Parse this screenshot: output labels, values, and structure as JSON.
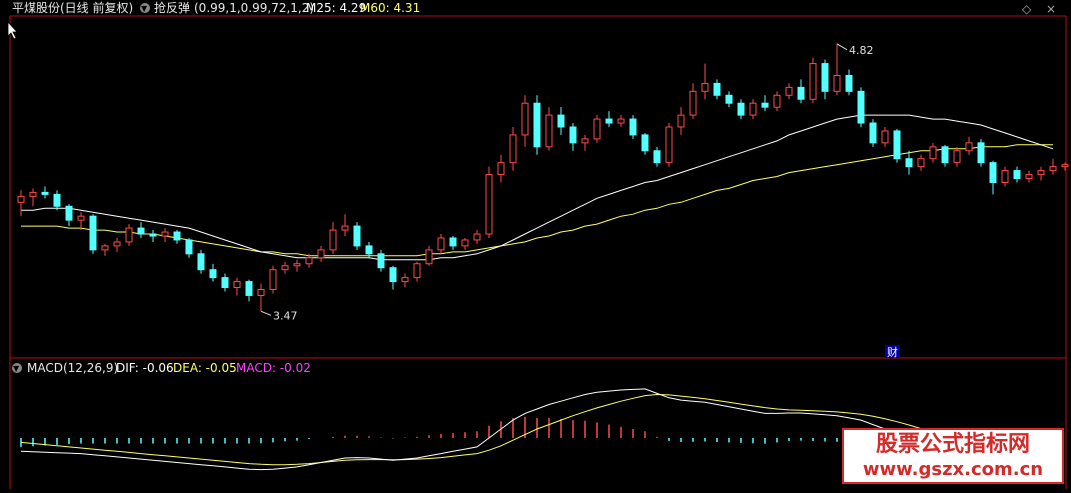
{
  "header": {
    "stock_title": "平煤股份(日线 前复权)",
    "indicator_name": "抢反弹",
    "indicator_params": "(0.99,1,0.99,72,1,2)",
    "m25_label": "M25: 4.29",
    "m60_label": "M60: 4.31"
  },
  "macd_header": {
    "label": "MACD(12,26,9)",
    "dif_label": "DIF: -0.06",
    "dea_label": "DEA: -0.05",
    "macd_label": "MACD: -0.02"
  },
  "markers": {
    "finance_label": "财"
  },
  "watermark": {
    "line1": "股票公式指标网",
    "line2": "www.gszx.com.cn"
  },
  "colors": {
    "up": "#ff4a4a",
    "down": "#54ffff",
    "ma25": "#ffffff",
    "ma60": "#ffff60",
    "dif": "#ffffff",
    "dea": "#ffff60",
    "macd_label": "#ff40ff",
    "border": "#b01010",
    "watermark": "#d42a2a"
  },
  "chart_data": [
    {
      "type": "candlestick",
      "title": "",
      "y_range": [
        3.3,
        4.95
      ],
      "annotations": [
        {
          "text": "4.82",
          "index": 68,
          "value": 4.82
        },
        {
          "text": "3.47",
          "index": 20,
          "value": 3.47
        }
      ],
      "series_legend": [
        {
          "name": "M25",
          "value": 4.29
        },
        {
          "name": "M60",
          "value": 4.31
        }
      ],
      "candles": [
        {
          "o": 4.02,
          "h": 4.08,
          "l": 3.95,
          "c": 4.05
        },
        {
          "o": 4.05,
          "h": 4.09,
          "l": 4.0,
          "c": 4.07
        },
        {
          "o": 4.07,
          "h": 4.1,
          "l": 4.04,
          "c": 4.06
        },
        {
          "o": 4.06,
          "h": 4.08,
          "l": 3.98,
          "c": 4.0
        },
        {
          "o": 4.0,
          "h": 4.01,
          "l": 3.9,
          "c": 3.93
        },
        {
          "o": 3.93,
          "h": 3.97,
          "l": 3.88,
          "c": 3.95
        },
        {
          "o": 3.95,
          "h": 3.96,
          "l": 3.76,
          "c": 3.78
        },
        {
          "o": 3.78,
          "h": 3.81,
          "l": 3.75,
          "c": 3.8
        },
        {
          "o": 3.8,
          "h": 3.84,
          "l": 3.77,
          "c": 3.82
        },
        {
          "o": 3.82,
          "h": 3.91,
          "l": 3.8,
          "c": 3.89
        },
        {
          "o": 3.89,
          "h": 3.92,
          "l": 3.84,
          "c": 3.86
        },
        {
          "o": 3.86,
          "h": 3.88,
          "l": 3.82,
          "c": 3.85
        },
        {
          "o": 3.85,
          "h": 3.89,
          "l": 3.82,
          "c": 3.87
        },
        {
          "o": 3.87,
          "h": 3.88,
          "l": 3.81,
          "c": 3.83
        },
        {
          "o": 3.83,
          "h": 3.84,
          "l": 3.74,
          "c": 3.76
        },
        {
          "o": 3.76,
          "h": 3.78,
          "l": 3.66,
          "c": 3.68
        },
        {
          "o": 3.68,
          "h": 3.71,
          "l": 3.62,
          "c": 3.64
        },
        {
          "o": 3.64,
          "h": 3.66,
          "l": 3.57,
          "c": 3.59
        },
        {
          "o": 3.59,
          "h": 3.64,
          "l": 3.55,
          "c": 3.62
        },
        {
          "o": 3.62,
          "h": 3.63,
          "l": 3.52,
          "c": 3.55
        },
        {
          "o": 3.55,
          "h": 3.61,
          "l": 3.47,
          "c": 3.58
        },
        {
          "o": 3.58,
          "h": 3.7,
          "l": 3.56,
          "c": 3.68
        },
        {
          "o": 3.68,
          "h": 3.72,
          "l": 3.66,
          "c": 3.7
        },
        {
          "o": 3.7,
          "h": 3.73,
          "l": 3.67,
          "c": 3.71
        },
        {
          "o": 3.71,
          "h": 3.76,
          "l": 3.69,
          "c": 3.74
        },
        {
          "o": 3.74,
          "h": 3.8,
          "l": 3.72,
          "c": 3.78
        },
        {
          "o": 3.78,
          "h": 3.92,
          "l": 3.76,
          "c": 3.88
        },
        {
          "o": 3.88,
          "h": 3.96,
          "l": 3.85,
          "c": 3.9
        },
        {
          "o": 3.9,
          "h": 3.92,
          "l": 3.78,
          "c": 3.8
        },
        {
          "o": 3.8,
          "h": 3.82,
          "l": 3.74,
          "c": 3.76
        },
        {
          "o": 3.76,
          "h": 3.78,
          "l": 3.67,
          "c": 3.69
        },
        {
          "o": 3.69,
          "h": 3.7,
          "l": 3.58,
          "c": 3.62
        },
        {
          "o": 3.62,
          "h": 3.66,
          "l": 3.59,
          "c": 3.64
        },
        {
          "o": 3.64,
          "h": 3.72,
          "l": 3.62,
          "c": 3.71
        },
        {
          "o": 3.71,
          "h": 3.8,
          "l": 3.7,
          "c": 3.78
        },
        {
          "o": 3.78,
          "h": 3.86,
          "l": 3.76,
          "c": 3.84
        },
        {
          "o": 3.84,
          "h": 3.85,
          "l": 3.78,
          "c": 3.8
        },
        {
          "o": 3.8,
          "h": 3.84,
          "l": 3.78,
          "c": 3.83
        },
        {
          "o": 3.83,
          "h": 3.88,
          "l": 3.81,
          "c": 3.86
        },
        {
          "o": 3.86,
          "h": 4.2,
          "l": 3.84,
          "c": 4.16
        },
        {
          "o": 4.16,
          "h": 4.26,
          "l": 4.12,
          "c": 4.22
        },
        {
          "o": 4.22,
          "h": 4.4,
          "l": 4.18,
          "c": 4.36
        },
        {
          "o": 4.36,
          "h": 4.56,
          "l": 4.3,
          "c": 4.52
        },
        {
          "o": 4.52,
          "h": 4.56,
          "l": 4.26,
          "c": 4.3
        },
        {
          "o": 4.3,
          "h": 4.5,
          "l": 4.28,
          "c": 4.46
        },
        {
          "o": 4.46,
          "h": 4.5,
          "l": 4.36,
          "c": 4.4
        },
        {
          "o": 4.4,
          "h": 4.42,
          "l": 4.28,
          "c": 4.32
        },
        {
          "o": 4.32,
          "h": 4.36,
          "l": 4.28,
          "c": 4.34
        },
        {
          "o": 4.34,
          "h": 4.46,
          "l": 4.32,
          "c": 4.44
        },
        {
          "o": 4.44,
          "h": 4.48,
          "l": 4.4,
          "c": 4.42
        },
        {
          "o": 4.42,
          "h": 4.46,
          "l": 4.4,
          "c": 4.44
        },
        {
          "o": 4.44,
          "h": 4.46,
          "l": 4.34,
          "c": 4.36
        },
        {
          "o": 4.36,
          "h": 4.37,
          "l": 4.26,
          "c": 4.28
        },
        {
          "o": 4.28,
          "h": 4.3,
          "l": 4.2,
          "c": 4.22
        },
        {
          "o": 4.22,
          "h": 4.42,
          "l": 4.2,
          "c": 4.4
        },
        {
          "o": 4.4,
          "h": 4.5,
          "l": 4.36,
          "c": 4.46
        },
        {
          "o": 4.46,
          "h": 4.62,
          "l": 4.44,
          "c": 4.58
        },
        {
          "o": 4.58,
          "h": 4.72,
          "l": 4.54,
          "c": 4.62
        },
        {
          "o": 4.62,
          "h": 4.64,
          "l": 4.54,
          "c": 4.56
        },
        {
          "o": 4.56,
          "h": 4.58,
          "l": 4.5,
          "c": 4.52
        },
        {
          "o": 4.52,
          "h": 4.54,
          "l": 4.44,
          "c": 4.46
        },
        {
          "o": 4.46,
          "h": 4.54,
          "l": 4.44,
          "c": 4.52
        },
        {
          "o": 4.52,
          "h": 4.56,
          "l": 4.48,
          "c": 4.5
        },
        {
          "o": 4.5,
          "h": 4.58,
          "l": 4.48,
          "c": 4.56
        },
        {
          "o": 4.56,
          "h": 4.62,
          "l": 4.54,
          "c": 4.6
        },
        {
          "o": 4.6,
          "h": 4.64,
          "l": 4.52,
          "c": 4.54
        },
        {
          "o": 4.54,
          "h": 4.75,
          "l": 4.52,
          "c": 4.72
        },
        {
          "o": 4.72,
          "h": 4.74,
          "l": 4.54,
          "c": 4.58
        },
        {
          "o": 4.58,
          "h": 4.82,
          "l": 4.56,
          "c": 4.66
        },
        {
          "o": 4.66,
          "h": 4.69,
          "l": 4.56,
          "c": 4.58
        },
        {
          "o": 4.58,
          "h": 4.6,
          "l": 4.4,
          "c": 4.42
        },
        {
          "o": 4.42,
          "h": 4.44,
          "l": 4.3,
          "c": 4.32
        },
        {
          "o": 4.32,
          "h": 4.4,
          "l": 4.3,
          "c": 4.38
        },
        {
          "o": 4.38,
          "h": 4.39,
          "l": 4.22,
          "c": 4.24
        },
        {
          "o": 4.24,
          "h": 4.28,
          "l": 4.16,
          "c": 4.2
        },
        {
          "o": 4.2,
          "h": 4.26,
          "l": 4.18,
          "c": 4.24
        },
        {
          "o": 4.24,
          "h": 4.32,
          "l": 4.22,
          "c": 4.3
        },
        {
          "o": 4.3,
          "h": 4.31,
          "l": 4.2,
          "c": 4.22
        },
        {
          "o": 4.22,
          "h": 4.3,
          "l": 4.2,
          "c": 4.28
        },
        {
          "o": 4.28,
          "h": 4.35,
          "l": 4.26,
          "c": 4.32
        },
        {
          "o": 4.32,
          "h": 4.34,
          "l": 4.2,
          "c": 4.22
        },
        {
          "o": 4.22,
          "h": 4.23,
          "l": 4.06,
          "c": 4.12
        },
        {
          "o": 4.12,
          "h": 4.2,
          "l": 4.1,
          "c": 4.18
        },
        {
          "o": 4.18,
          "h": 4.2,
          "l": 4.12,
          "c": 4.14
        },
        {
          "o": 4.14,
          "h": 4.18,
          "l": 4.12,
          "c": 4.16
        },
        {
          "o": 4.16,
          "h": 4.2,
          "l": 4.13,
          "c": 4.18
        },
        {
          "o": 4.18,
          "h": 4.24,
          "l": 4.16,
          "c": 4.2
        },
        {
          "o": 4.2,
          "h": 4.22,
          "l": 4.18,
          "c": 4.21
        }
      ],
      "ma25": [
        3.98,
        3.98,
        3.99,
        3.99,
        3.99,
        3.98,
        3.97,
        3.96,
        3.95,
        3.94,
        3.93,
        3.92,
        3.91,
        3.9,
        3.89,
        3.87,
        3.85,
        3.83,
        3.81,
        3.79,
        3.77,
        3.76,
        3.75,
        3.74,
        3.74,
        3.74,
        3.74,
        3.74,
        3.74,
        3.74,
        3.73,
        3.73,
        3.73,
        3.73,
        3.73,
        3.74,
        3.74,
        3.75,
        3.76,
        3.78,
        3.8,
        3.83,
        3.86,
        3.89,
        3.92,
        3.95,
        3.98,
        4.01,
        4.04,
        4.06,
        4.08,
        4.1,
        4.12,
        4.13,
        4.15,
        4.17,
        4.19,
        4.21,
        4.23,
        4.25,
        4.27,
        4.29,
        4.31,
        4.33,
        4.36,
        4.38,
        4.4,
        4.42,
        4.44,
        4.45,
        4.46,
        4.46,
        4.46,
        4.46,
        4.46,
        4.45,
        4.44,
        4.44,
        4.43,
        4.42,
        4.41,
        4.39,
        4.37,
        4.35,
        4.33,
        4.31,
        4.29
      ],
      "ma60": [
        3.9,
        3.9,
        3.9,
        3.9,
        3.89,
        3.89,
        3.88,
        3.88,
        3.87,
        3.87,
        3.86,
        3.86,
        3.85,
        3.84,
        3.83,
        3.82,
        3.81,
        3.8,
        3.79,
        3.78,
        3.77,
        3.77,
        3.76,
        3.76,
        3.75,
        3.75,
        3.75,
        3.75,
        3.75,
        3.75,
        3.75,
        3.75,
        3.75,
        3.75,
        3.76,
        3.76,
        3.77,
        3.77,
        3.78,
        3.79,
        3.8,
        3.81,
        3.82,
        3.84,
        3.85,
        3.87,
        3.88,
        3.9,
        3.91,
        3.93,
        3.95,
        3.96,
        3.98,
        3.99,
        4.01,
        4.02,
        4.04,
        4.06,
        4.08,
        4.09,
        4.11,
        4.13,
        4.14,
        4.15,
        4.17,
        4.18,
        4.19,
        4.2,
        4.21,
        4.22,
        4.23,
        4.24,
        4.25,
        4.26,
        4.27,
        4.28,
        4.28,
        4.29,
        4.29,
        4.29,
        4.3,
        4.3,
        4.3,
        4.31,
        4.31,
        4.31,
        4.31
      ]
    },
    {
      "type": "macd",
      "title": "MACD(12,26,9)",
      "y_range": [
        -0.22,
        0.26
      ],
      "dif": [
        -0.06,
        -0.062,
        -0.064,
        -0.066,
        -0.068,
        -0.07,
        -0.075,
        -0.08,
        -0.085,
        -0.09,
        -0.095,
        -0.1,
        -0.105,
        -0.11,
        -0.115,
        -0.12,
        -0.125,
        -0.13,
        -0.135,
        -0.14,
        -0.142,
        -0.14,
        -0.135,
        -0.13,
        -0.12,
        -0.11,
        -0.1,
        -0.09,
        -0.088,
        -0.09,
        -0.095,
        -0.1,
        -0.095,
        -0.09,
        -0.08,
        -0.07,
        -0.06,
        -0.05,
        -0.04,
        0.0,
        0.04,
        0.08,
        0.11,
        0.13,
        0.15,
        0.165,
        0.18,
        0.195,
        0.205,
        0.21,
        0.215,
        0.218,
        0.22,
        0.2,
        0.18,
        0.17,
        0.165,
        0.16,
        0.15,
        0.14,
        0.13,
        0.12,
        0.11,
        0.11,
        0.112,
        0.112,
        0.108,
        0.104,
        0.1,
        0.09,
        0.08,
        0.06,
        0.04,
        0.02,
        0.0,
        -0.02,
        -0.03,
        -0.04,
        -0.045,
        -0.05,
        -0.052,
        -0.054,
        -0.055,
        -0.056,
        -0.058,
        -0.059,
        -0.06
      ],
      "dea": [
        -0.02,
        -0.025,
        -0.03,
        -0.035,
        -0.04,
        -0.045,
        -0.05,
        -0.055,
        -0.06,
        -0.065,
        -0.07,
        -0.075,
        -0.08,
        -0.085,
        -0.09,
        -0.095,
        -0.1,
        -0.105,
        -0.11,
        -0.115,
        -0.118,
        -0.12,
        -0.12,
        -0.118,
        -0.115,
        -0.11,
        -0.105,
        -0.1,
        -0.098,
        -0.097,
        -0.097,
        -0.098,
        -0.097,
        -0.095,
        -0.092,
        -0.088,
        -0.082,
        -0.076,
        -0.07,
        -0.055,
        -0.035,
        -0.01,
        0.015,
        0.04,
        0.06,
        0.08,
        0.1,
        0.118,
        0.135,
        0.15,
        0.165,
        0.178,
        0.19,
        0.195,
        0.193,
        0.188,
        0.182,
        0.176,
        0.168,
        0.16,
        0.152,
        0.144,
        0.136,
        0.13,
        0.126,
        0.124,
        0.122,
        0.12,
        0.117,
        0.112,
        0.106,
        0.097,
        0.086,
        0.073,
        0.058,
        0.042,
        0.028,
        0.015,
        0.003,
        -0.008,
        -0.018,
        -0.026,
        -0.033,
        -0.039,
        -0.044,
        -0.048,
        -0.05
      ],
      "histogram": [
        -0.04,
        -0.037,
        -0.034,
        -0.031,
        -0.028,
        -0.025,
        -0.025,
        -0.025,
        -0.025,
        -0.025,
        -0.025,
        -0.025,
        -0.025,
        -0.025,
        -0.025,
        -0.025,
        -0.025,
        -0.025,
        -0.025,
        -0.025,
        -0.024,
        -0.02,
        -0.015,
        -0.012,
        -0.005,
        0.0,
        0.005,
        0.01,
        0.01,
        0.007,
        0.002,
        -0.002,
        0.002,
        0.005,
        0.012,
        0.018,
        0.022,
        0.026,
        0.03,
        0.055,
        0.075,
        0.09,
        0.095,
        0.09,
        0.09,
        0.085,
        0.08,
        0.077,
        0.07,
        0.06,
        0.05,
        0.04,
        0.03,
        0.005,
        -0.013,
        -0.018,
        -0.017,
        -0.016,
        -0.018,
        -0.02,
        -0.022,
        -0.024,
        -0.026,
        -0.02,
        -0.014,
        -0.012,
        -0.014,
        -0.016,
        -0.017,
        -0.022,
        -0.026,
        -0.037,
        -0.046,
        -0.053,
        -0.058,
        -0.062,
        -0.058,
        -0.055,
        -0.048,
        -0.042,
        -0.034,
        -0.028,
        -0.022,
        -0.017,
        -0.014,
        -0.011,
        -0.01
      ]
    }
  ]
}
